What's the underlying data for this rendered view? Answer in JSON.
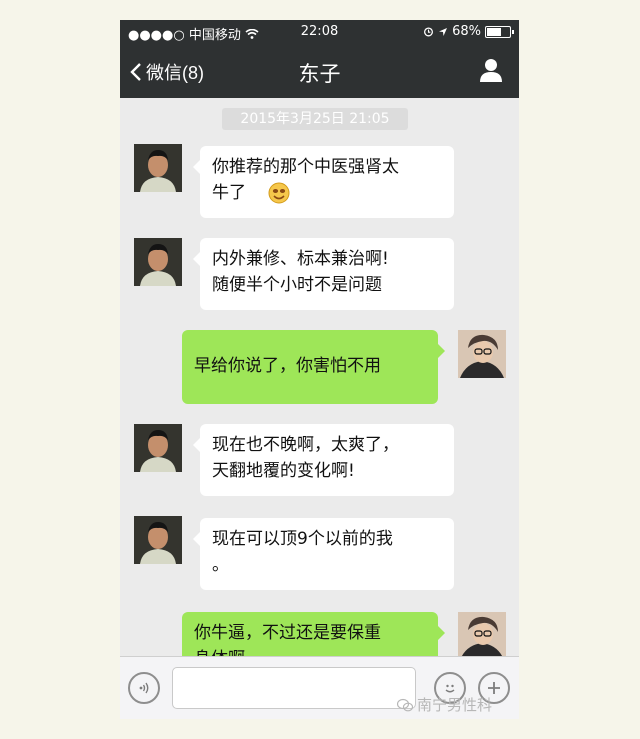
{
  "status_bar": {
    "carrier": "●●●●○ 中国移动",
    "time": "22:08",
    "battery_percent": "68%",
    "battery_level": 0.68
  },
  "nav": {
    "back_label": "微信(8)",
    "title": "东子"
  },
  "chat": {
    "timestamp": "2015年3月25日 21:05",
    "messages": [
      {
        "from": "left",
        "line1": "你推荐的那个中医强肾太",
        "line2": "牛了"
      },
      {
        "from": "left",
        "line1": "内外兼修、标本兼治啊!",
        "line2": "随便半个小时不是问题"
      },
      {
        "from": "me",
        "line1": "早给你说了，你害怕不用"
      },
      {
        "from": "left",
        "line1": "现在也不晚啊，太爽了，",
        "line2": "天翻地覆的变化啊!"
      },
      {
        "from": "left",
        "line1": "现在可以顶9个以前的我",
        "line2": "。"
      },
      {
        "from": "me",
        "line1": "你牛逼，不过还是要保重",
        "line2": "身体啊"
      }
    ]
  },
  "input_bar": {
    "watermark": "南宁男性科"
  },
  "colors": {
    "nav_bg": "#2e3132",
    "chat_bg": "#ebebeb",
    "my_bubble": "#9ee658",
    "their_bubble": "#ffffff"
  }
}
